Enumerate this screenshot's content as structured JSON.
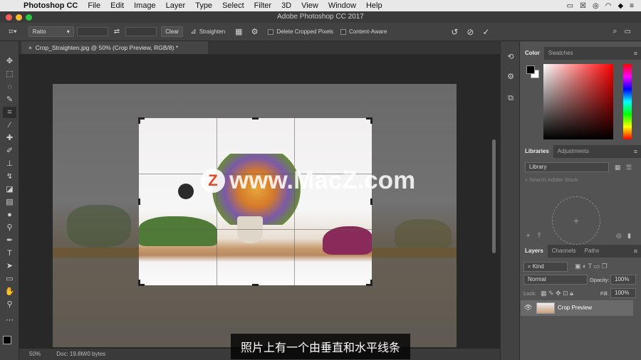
{
  "menubar": {
    "app": "Photoshop CC",
    "items": [
      "File",
      "Edit",
      "Image",
      "Layer",
      "Type",
      "Select",
      "Filter",
      "3D",
      "View",
      "Window",
      "Help"
    ]
  },
  "window": {
    "title": "Adobe Photoshop CC 2017"
  },
  "options": {
    "ratio_select": "Ratio",
    "clear_button": "Clear",
    "straighten_label": "Straighten",
    "delete_cropped_label": "Delete Cropped Pixels",
    "content_aware_label": "Content-Aware"
  },
  "document": {
    "tab_title": "Crop_Straighten.jpg @ 50% (Crop Preview, RGB/8) *",
    "zoom": "50%",
    "doc_info": "Doc: 19.8M/0 bytes"
  },
  "watermark": {
    "logo": "Z",
    "text": "www.MacZ.com"
  },
  "subtitle": "照片上有一个由垂直和水平线条",
  "color_panel": {
    "tabs": [
      "Color",
      "Swatches"
    ],
    "foreground": "#000000",
    "background": "#ffffff"
  },
  "libraries_panel": {
    "tabs": [
      "Libraries",
      "Adjustments"
    ],
    "library_select": "Library",
    "search_placeholder": "Search Adobe Stock"
  },
  "layers_panel": {
    "tabs": [
      "Layers",
      "Channels",
      "Paths"
    ],
    "filter_kind": "Kind",
    "blend_mode": "Normal",
    "opacity_label": "Opacity:",
    "opacity_value": "100%",
    "lock_label": "Lock:",
    "fill_label": "Fill:",
    "fill_value": "100%",
    "layers": [
      {
        "name": "Crop Preview",
        "visible": true
      }
    ]
  }
}
